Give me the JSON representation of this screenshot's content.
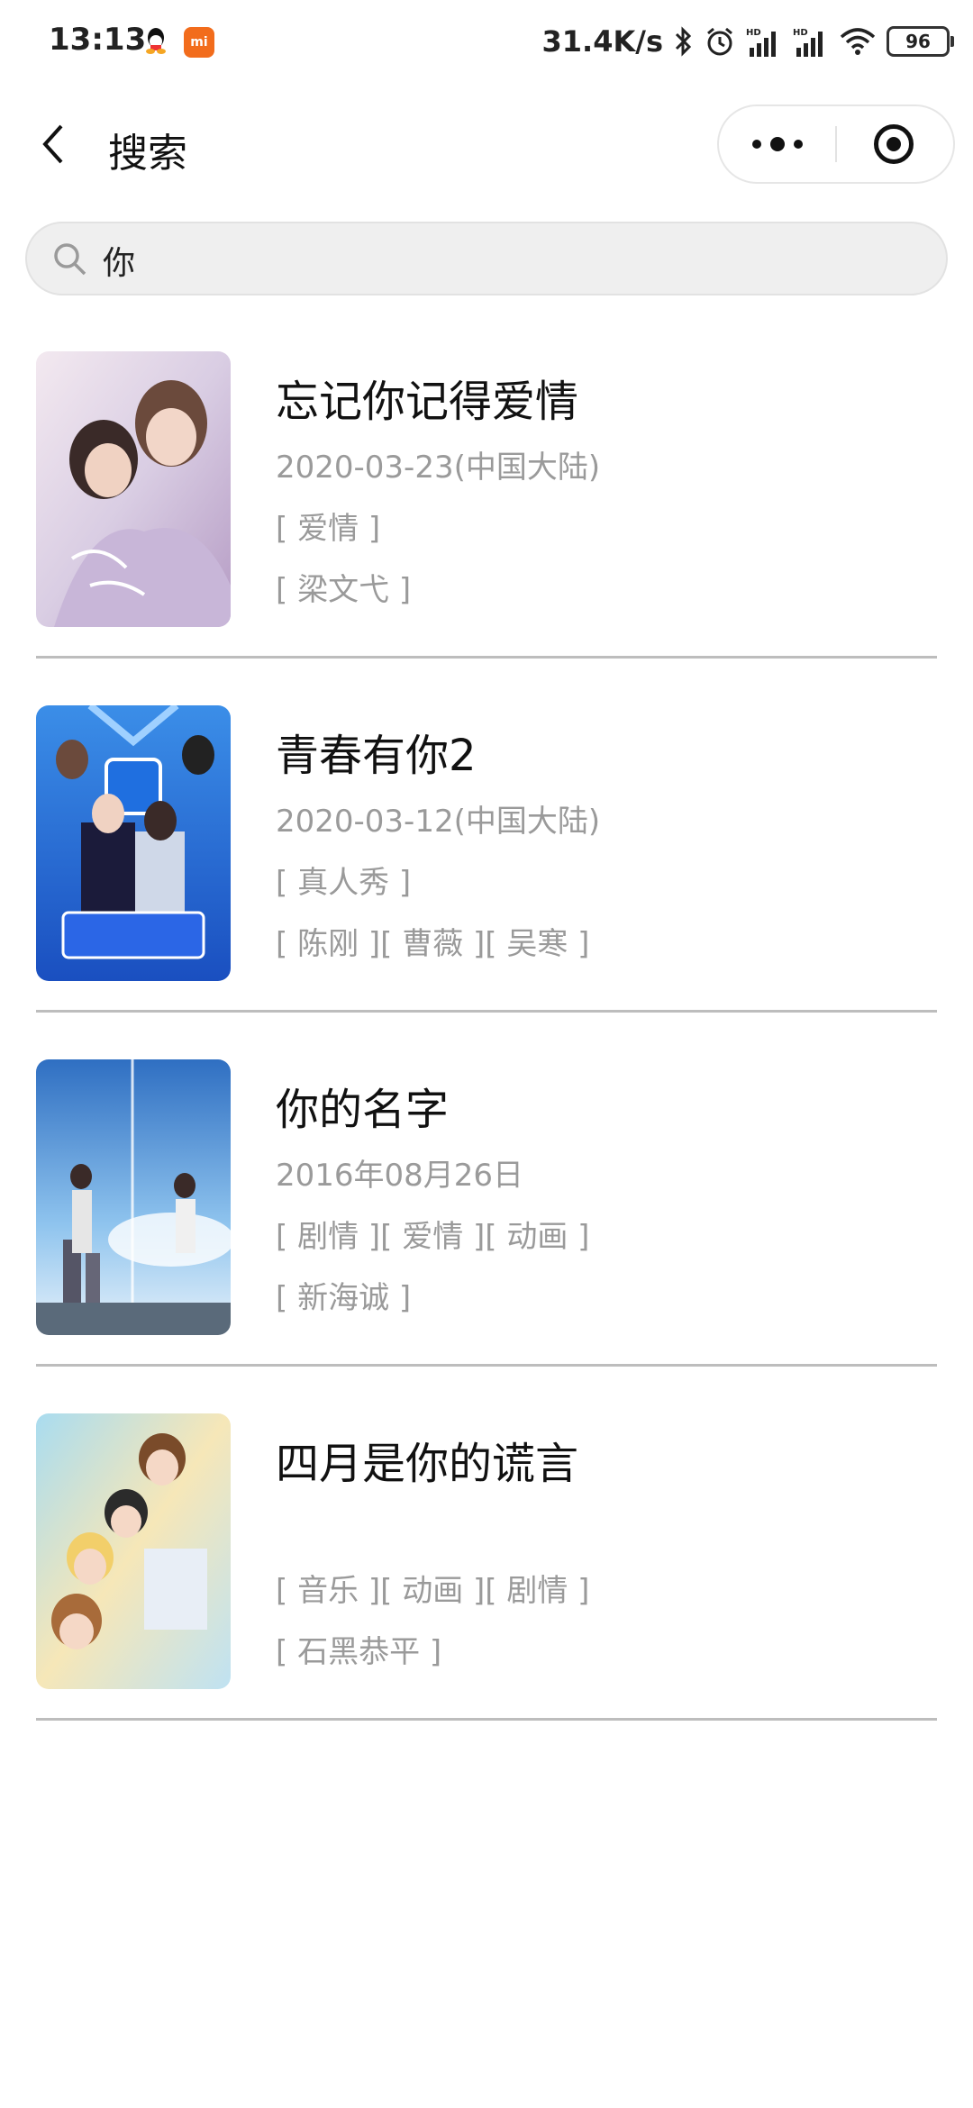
{
  "status_bar": {
    "time": "13:13",
    "speed": "31.4K/s",
    "battery": "96"
  },
  "navbar": {
    "title": "搜索"
  },
  "search": {
    "value": "你"
  },
  "results": [
    {
      "title": "忘记你记得爱情",
      "date": "2020-03-23(中国大陆)",
      "genres": "[ 爱情 ]",
      "people": "[ 梁文弋 ]"
    },
    {
      "title": "青春有你2",
      "date": "2020-03-12(中国大陆)",
      "genres": "[ 真人秀 ]",
      "people": "[ 陈刚 ][ 曹薇 ][ 吴寒 ]"
    },
    {
      "title": "你的名字",
      "date": "2016年08月26日",
      "genres": "[ 剧情 ][ 爱情 ][ 动画 ]",
      "people": "[ 新海诚 ]"
    },
    {
      "title": "四月是你的谎言",
      "date": "",
      "genres": "[ 音乐 ][ 动画 ][ 剧情 ]",
      "people": "[ 石黑恭平 ]"
    }
  ]
}
